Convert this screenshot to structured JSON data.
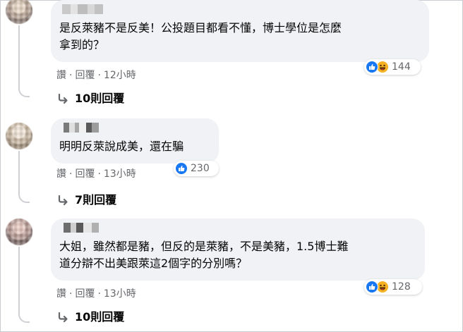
{
  "comments": [
    {
      "text": "是反萊豬不是反美！公投題目都看不懂，博士學位是怎麼\n拿到的？",
      "like_label": "讚",
      "reply_label": "回覆",
      "time": "12小時",
      "reaction_count": "144",
      "reaction_icons": [
        "like-icon",
        "haha-icon"
      ],
      "replies_label": "10則回覆"
    },
    {
      "text": "明明反萊說成美，還在騙",
      "like_label": "讚",
      "reply_label": "回覆",
      "time": "13小時",
      "reaction_count": "230",
      "reaction_icons": [
        "like-icon"
      ],
      "replies_label": "7則回覆"
    },
    {
      "text": "大姐，雖然都是豬，但反的是萊豬，不是美豬，1.5博士難\n道分辯不出美跟萊這2個字的分別嗎？",
      "like_label": "讚",
      "reply_label": "回覆",
      "time": "13小時",
      "reaction_count": "128",
      "reaction_icons": [
        "like-icon",
        "haha-icon"
      ],
      "replies_label": "10則回覆"
    }
  ],
  "colors": {
    "bubble": "#f0f2f5",
    "text": "#050505",
    "meta": "#65676b",
    "like_blue": "#1877f2",
    "haha_yellow": "#f7b125"
  }
}
